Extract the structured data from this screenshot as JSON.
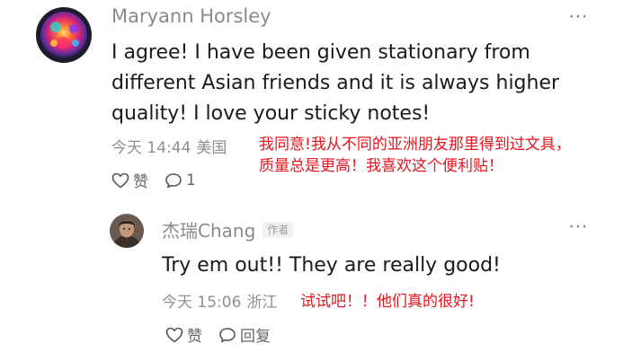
{
  "comment": {
    "author": "Maryann Horsley",
    "text": "I agree! I have been given stationary from different Asian friends and it is always higher quality! I love your sticky notes!",
    "time": "今天 14:44",
    "location": "美国",
    "translation": "我同意!我从不同的亚洲朋友那里得到过文具，质量总是更高！我喜欢这个便利贴！",
    "like_label": "赞",
    "reply_count": "1",
    "more_icon": "⋯"
  },
  "reply": {
    "author": "杰瑞Chang",
    "author_badge": "作者",
    "text": "Try em out!! They are really good!",
    "time": "今天 15:06",
    "location": "浙江",
    "translation": "试试吧！！他们真的很好!",
    "like_label": "赞",
    "reply_label": "回复",
    "more_icon": "⋯"
  },
  "colors": {
    "translation": "#e4151d",
    "meta": "#8f8f8f",
    "author": "#8a8a8a"
  },
  "icons": {
    "like": "heart-outline-icon",
    "comment": "speech-bubble-icon",
    "more": "more-horizontal-icon"
  }
}
